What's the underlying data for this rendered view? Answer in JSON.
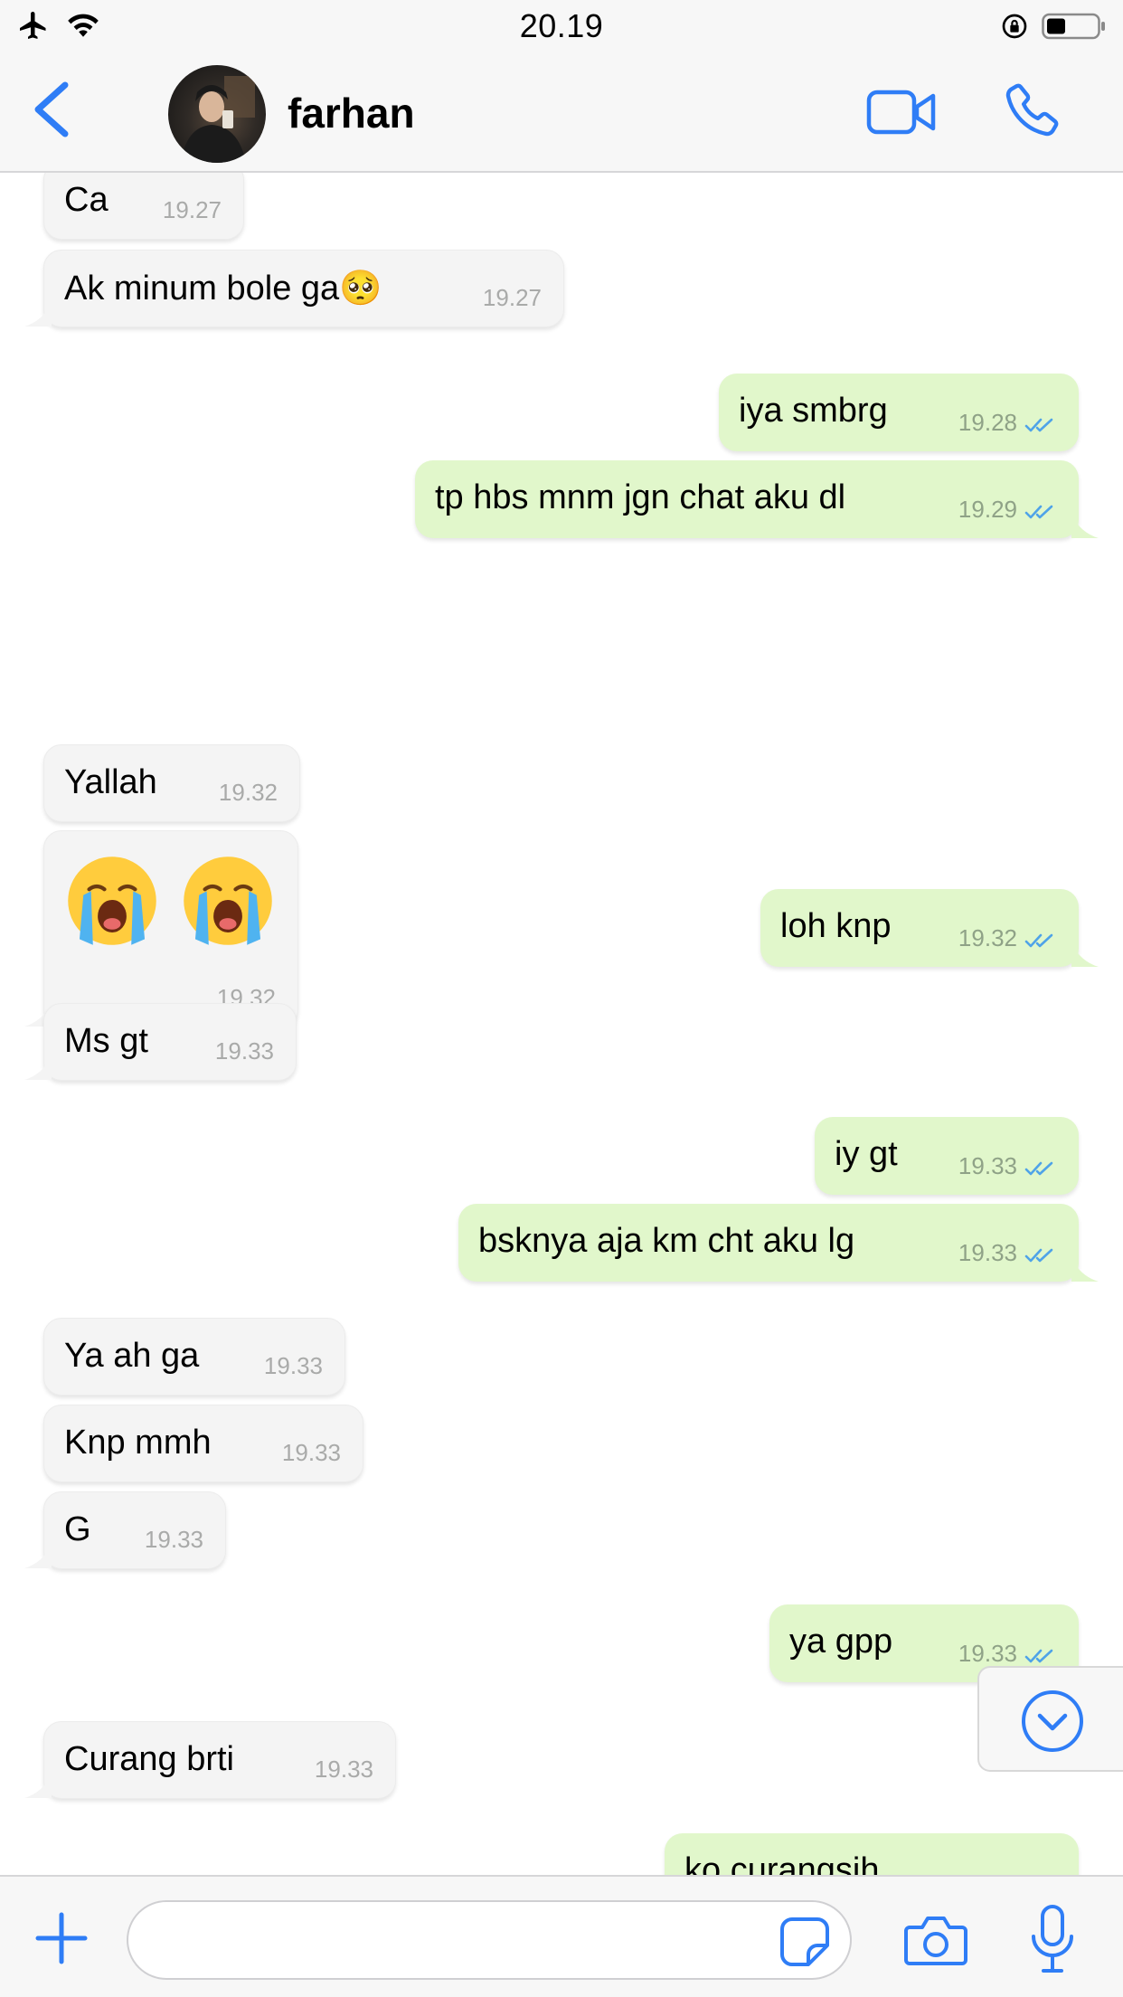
{
  "status_bar": {
    "time": "20.19"
  },
  "header": {
    "contact_name": "farhan"
  },
  "messages": [
    {
      "dir": "in",
      "text": "Ca",
      "time": "19.27"
    },
    {
      "dir": "in",
      "text": "Ak minum bole ga🥺",
      "time": "19.27"
    },
    {
      "dir": "out",
      "text": "iya smbrg",
      "time": "19.28",
      "read": true
    },
    {
      "dir": "out",
      "text": "tp hbs mnm jgn chat aku dl",
      "time": "19.29",
      "read": true
    },
    {
      "dir": "in",
      "text": "Yallah",
      "time": "19.32"
    },
    {
      "dir": "in",
      "text": "😭 😭",
      "time": "19.32"
    },
    {
      "dir": "out",
      "text": "loh knp",
      "time": "19.32",
      "read": true
    },
    {
      "dir": "in",
      "text": "Ms gt",
      "time": "19.33"
    },
    {
      "dir": "out",
      "text": "iy gt",
      "time": "19.33",
      "read": true
    },
    {
      "dir": "out",
      "text": "bsknya aja km cht aku lg",
      "time": "19.33",
      "read": true
    },
    {
      "dir": "in",
      "text": "Ya ah ga",
      "time": "19.33"
    },
    {
      "dir": "in",
      "text": "Knp mmh",
      "time": "19.33"
    },
    {
      "dir": "in",
      "text": "G",
      "time": "19.33"
    },
    {
      "dir": "out",
      "text": "ya gpp",
      "time": "19.33",
      "read": true
    },
    {
      "dir": "in",
      "text": "Curang brti",
      "time": "19.33"
    },
    {
      "dir": "out",
      "text": "ko curangsih",
      "time": "",
      "read": true
    }
  ],
  "input": {
    "placeholder": "",
    "value": ""
  },
  "icons": {
    "back": "chevron-left-icon",
    "video": "video-camera-icon",
    "call": "phone-icon",
    "add": "plus-icon",
    "sticker": "sticker-icon",
    "camera": "camera-icon",
    "mic": "microphone-icon",
    "scroll_down": "chevron-down-circle-icon"
  },
  "colors": {
    "accent": "#2f7df6",
    "outgoing_bubble": "#e1f7cb",
    "incoming_bubble": "#f4f4f4",
    "read_ticks": "#4fa3e8"
  }
}
